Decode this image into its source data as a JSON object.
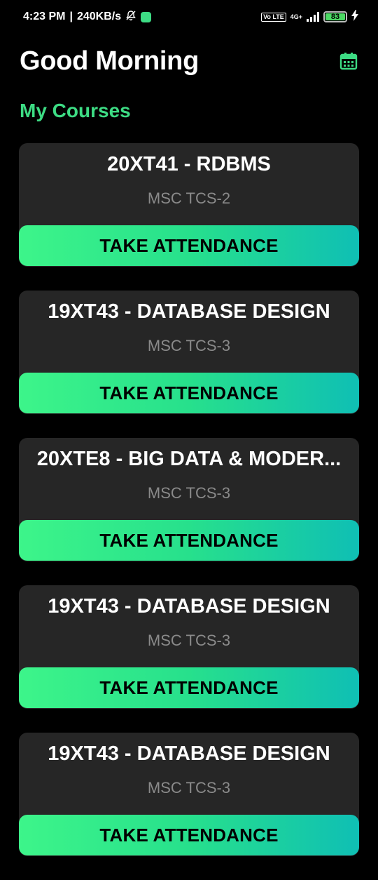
{
  "status_bar": {
    "time": "4:23 PM",
    "speed": "240KB/s",
    "network": "4G+",
    "volte": "Vo LTE",
    "battery": "83"
  },
  "header": {
    "title": "Good Morning",
    "calendar_icon": "calendar-icon",
    "accent": "#3ddc84"
  },
  "section": {
    "title": "My Courses"
  },
  "courses": [
    {
      "title": "20XT41 - RDBMS",
      "class": "MSC TCS-2",
      "button": "TAKE ATTENDANCE"
    },
    {
      "title": "19XT43 - DATABASE DESIGN",
      "class": "MSC TCS-3",
      "button": "TAKE ATTENDANCE"
    },
    {
      "title": "20XTE8 - BIG DATA & MODER...",
      "class": "MSC TCS-3",
      "button": "TAKE ATTENDANCE"
    },
    {
      "title": "19XT43 - DATABASE DESIGN",
      "class": "MSC TCS-3",
      "button": "TAKE ATTENDANCE"
    },
    {
      "title": "19XT43 - DATABASE DESIGN",
      "class": "MSC TCS-3",
      "button": "TAKE ATTENDANCE"
    }
  ]
}
